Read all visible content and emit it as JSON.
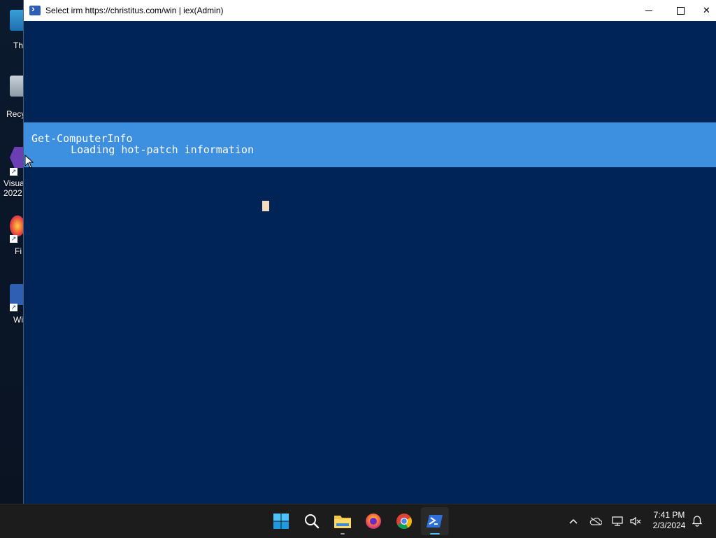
{
  "desktop": {
    "icons": [
      {
        "label": "Th",
        "name": "this-pc"
      },
      {
        "label": "Recy",
        "name": "recycle-bin"
      },
      {
        "label": "Visua\n2022",
        "label1": "Visua",
        "label2": "2022",
        "name": "visual-studio-2022"
      },
      {
        "label": "Fi",
        "name": "firefox"
      },
      {
        "label": "Wi",
        "name": "winutil"
      }
    ]
  },
  "window": {
    "title": "Select irm https://christitus.com/win | iex(Admin)",
    "controls": {
      "minimize": "—",
      "maximize": "☐",
      "close": "✕"
    }
  },
  "console": {
    "progress_activity": "Get-ComputerInfo",
    "progress_status": "   Loading hot-patch information",
    "colors": {
      "background": "#012456",
      "progress_band": "#3d8fe0",
      "cursor": "#f5dcc0"
    }
  },
  "taskbar": {
    "apps": [
      {
        "name": "start",
        "icon": "windows-start-icon"
      },
      {
        "name": "search",
        "icon": "search-icon"
      },
      {
        "name": "file-explorer",
        "icon": "folder-icon"
      },
      {
        "name": "firefox",
        "icon": "firefox-icon"
      },
      {
        "name": "chrome",
        "icon": "chrome-icon"
      },
      {
        "name": "powershell",
        "icon": "powershell-icon",
        "active": true
      }
    ],
    "tray": {
      "time": "7:41 PM",
      "date": "2/3/2024"
    }
  }
}
